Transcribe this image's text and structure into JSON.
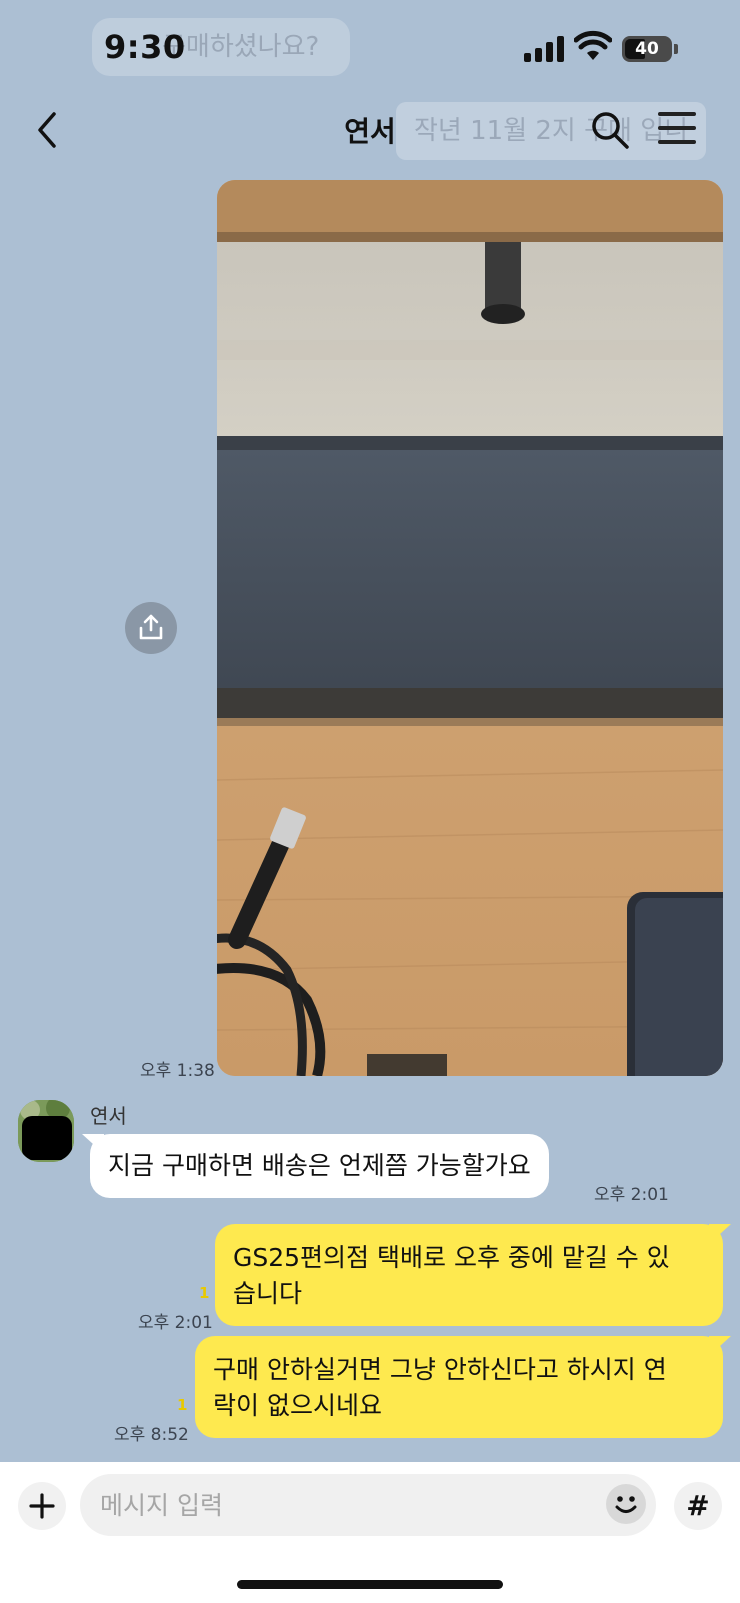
{
  "status_bar": {
    "time": "9:30",
    "battery": "40",
    "ghost_text": "구매하셨나요?"
  },
  "header": {
    "title": "연서",
    "ghost_notice": "작년 11월 2지 구매 입니",
    "icons": [
      "chevron-left-icon",
      "search-icon",
      "menu-icon"
    ]
  },
  "messages": {
    "photo": {
      "time": "오후 1:38"
    },
    "incoming": {
      "sender": "연서",
      "text": "지금 구매하면 배송은 언제쯤 가능할가요",
      "time": "오후 2:01"
    },
    "outgoing": [
      {
        "line1": "GS25편의점 택배로 오후 중에 맡길 수 있",
        "line2": "습니다",
        "unread": "1",
        "time": "오후 2:01"
      },
      {
        "line1": "구매 안하실거면 그냥 안하신다고 하시지 연",
        "line2": "락이 없으시네요",
        "unread": "1",
        "time": "오후 8:52"
      }
    ]
  },
  "input": {
    "placeholder": "메시지 입력",
    "hash_label": "#"
  },
  "colors": {
    "background": "#acbfd3",
    "outgoing_bubble": "#fee94f",
    "incoming_bubble": "#ffffff",
    "unread_count": "#e8c900"
  }
}
